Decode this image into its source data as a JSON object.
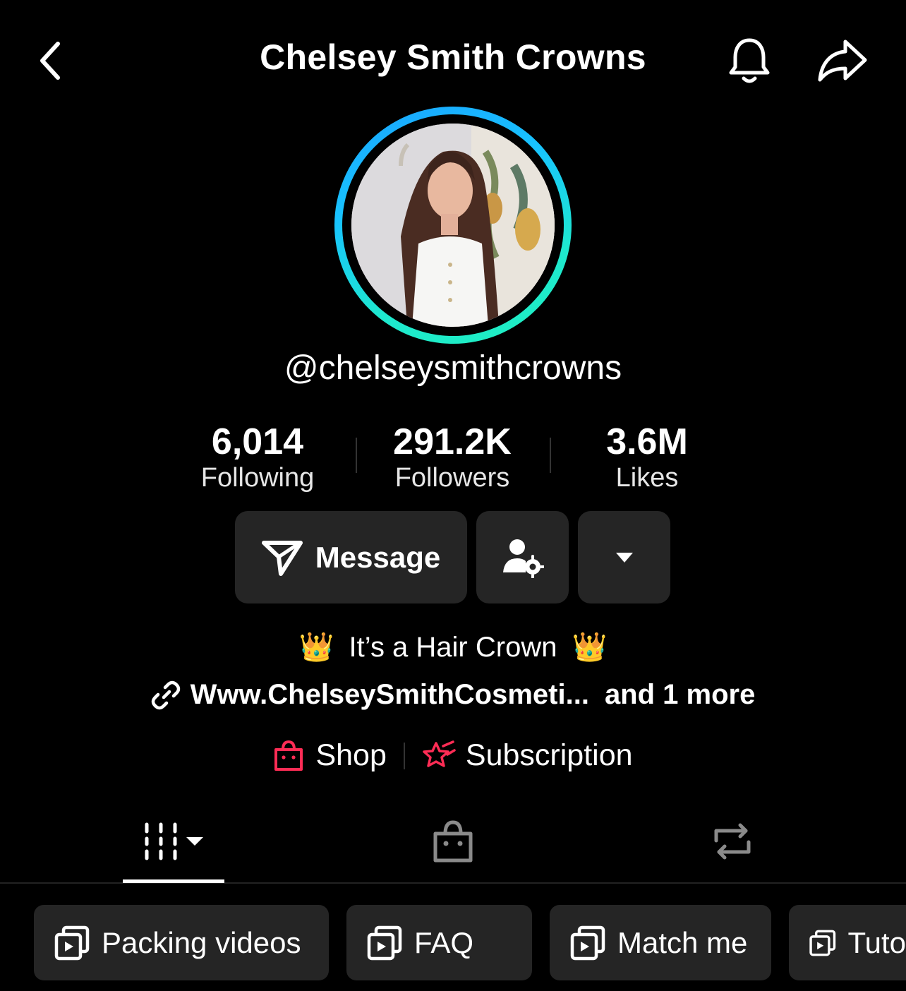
{
  "header": {
    "title": "Chelsey Smith Crowns",
    "back_icon": "chevron-left-icon",
    "bell_icon": "bell-icon",
    "share_icon": "share-icon"
  },
  "profile": {
    "username": "@chelseysmithcrowns",
    "ring_colors": [
      "#1aa3ff",
      "#1ff0c0"
    ]
  },
  "stats": [
    {
      "value": "6,014",
      "label": "Following"
    },
    {
      "value": "291.2K",
      "label": "Followers"
    },
    {
      "value": "3.6M",
      "label": "Likes"
    }
  ],
  "actions": {
    "message_label": "Message",
    "message_icon": "send-icon",
    "manage_icon": "person-settings-icon",
    "more_icon": "caret-down-icon"
  },
  "bio": {
    "text": "It’s a Hair Crown",
    "crown_emoji": "👑",
    "link_text": "Www.ChelseySmithCosmeti...",
    "link_more": "and 1 more"
  },
  "commerce": {
    "shop_label": "Shop",
    "subscription_label": "Subscription",
    "accent": "#fe2c55"
  },
  "tabs": {
    "videos_icon": "grid-icon",
    "shop_icon": "shopping-bag-icon",
    "repost_icon": "repost-icon"
  },
  "playlists": [
    {
      "label": "Packing videos"
    },
    {
      "label": "FAQ"
    },
    {
      "label": "Match me"
    },
    {
      "label": "Tuto"
    }
  ]
}
